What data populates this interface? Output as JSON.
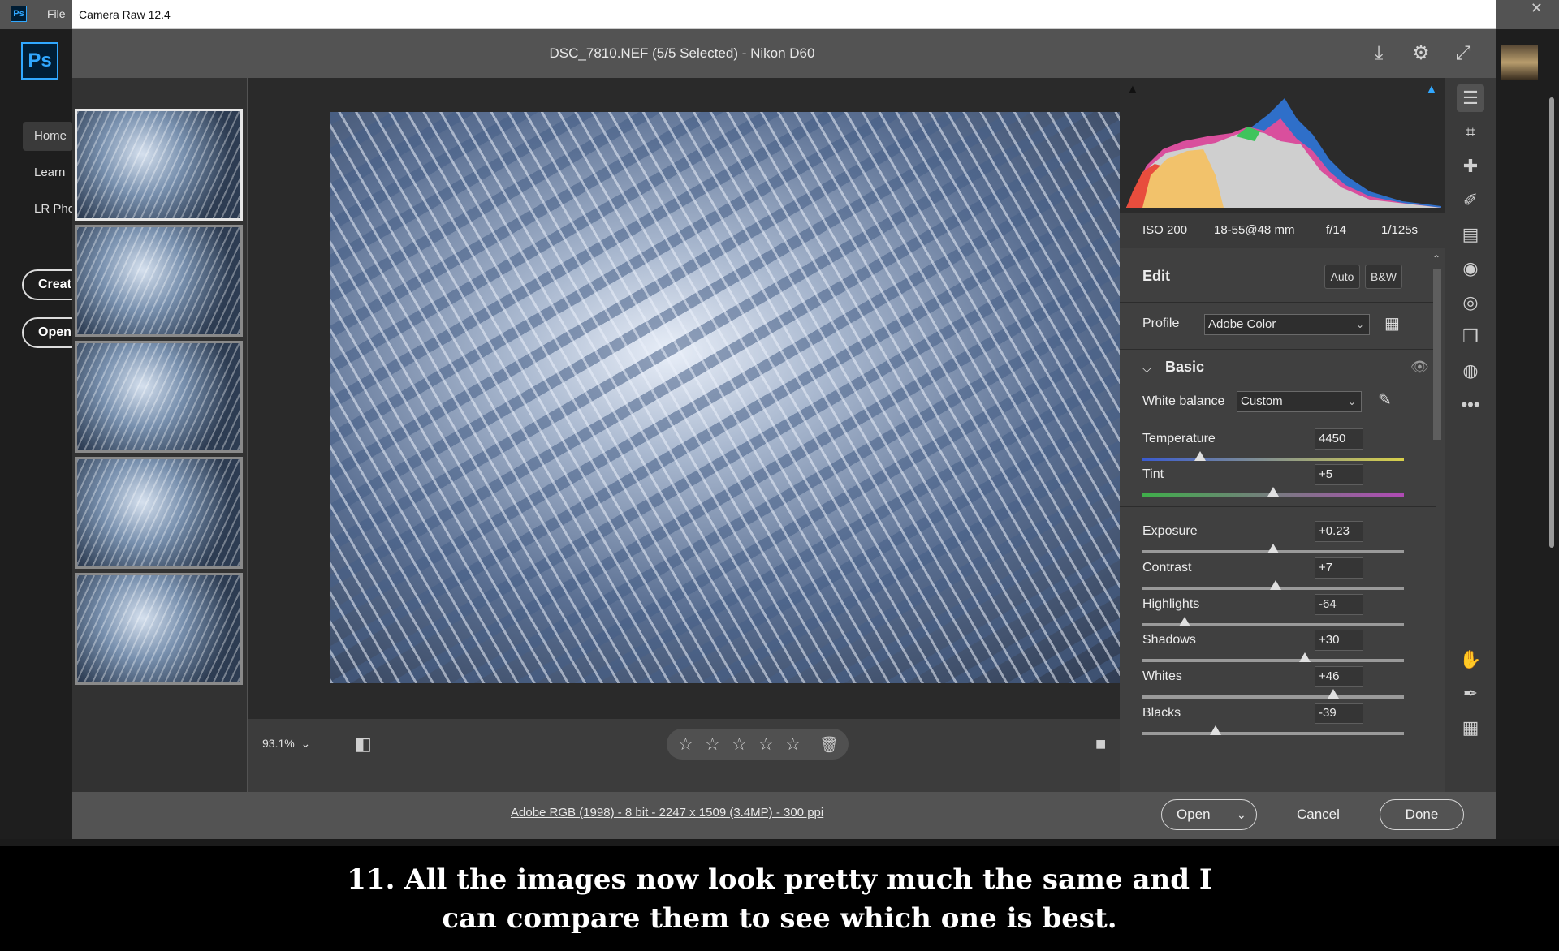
{
  "photoshop": {
    "file_menu": "File",
    "logo": "Ps",
    "nav": [
      "Home",
      "Learn",
      "LR Phc"
    ],
    "create_label": "Creat",
    "open_label": "Open"
  },
  "dialog": {
    "window_title": "Camera Raw 12.4",
    "header_title": "DSC_7810.NEF (5/5 Selected)  -  Nikon D60",
    "header_icons": [
      "save-icon",
      "gear-icon",
      "fullscreen-icon"
    ]
  },
  "filmstrip": {
    "count": 5,
    "selected_index": 0
  },
  "camera_info": {
    "iso": "ISO 200",
    "lens": "18-55@48 mm",
    "aperture": "f/14",
    "shutter": "1/125s"
  },
  "edit": {
    "title": "Edit",
    "auto_label": "Auto",
    "bw_label": "B&W",
    "profile_label": "Profile",
    "profile_value": "Adobe Color",
    "basic_title": "Basic",
    "white_balance_label": "White balance",
    "white_balance_value": "Custom",
    "sliders": [
      {
        "label": "Temperature",
        "value": "4450",
        "level": 0.22
      },
      {
        "label": "Tint",
        "value": "+5",
        "level": 0.5
      },
      {
        "label": "Exposure",
        "value": "+0.23",
        "level": 0.5
      },
      {
        "label": "Contrast",
        "value": "+7",
        "level": 0.51
      },
      {
        "label": "Highlights",
        "value": "-64",
        "level": 0.16
      },
      {
        "label": "Shadows",
        "value": "+30",
        "level": 0.62
      },
      {
        "label": "Whites",
        "value": "+46",
        "level": 0.73
      },
      {
        "label": "Blacks",
        "value": "-39",
        "level": 0.28
      }
    ]
  },
  "toolbar": {
    "zoom": "93.1%",
    "stars": 5
  },
  "footer": {
    "workflow_link": "Adobe RGB (1998) - 8 bit - 2247 x 1509 (3.4MP) - 300 ppi",
    "open_label": "Open",
    "cancel_label": "Cancel",
    "done_label": "Done"
  },
  "caption": {
    "line1": "11. All the images now look pretty much the same and I",
    "line2": "can compare them to see which one is best."
  },
  "colors": {
    "accent": "#31a8ff",
    "panel": "#404040",
    "dialog": "#535353"
  }
}
